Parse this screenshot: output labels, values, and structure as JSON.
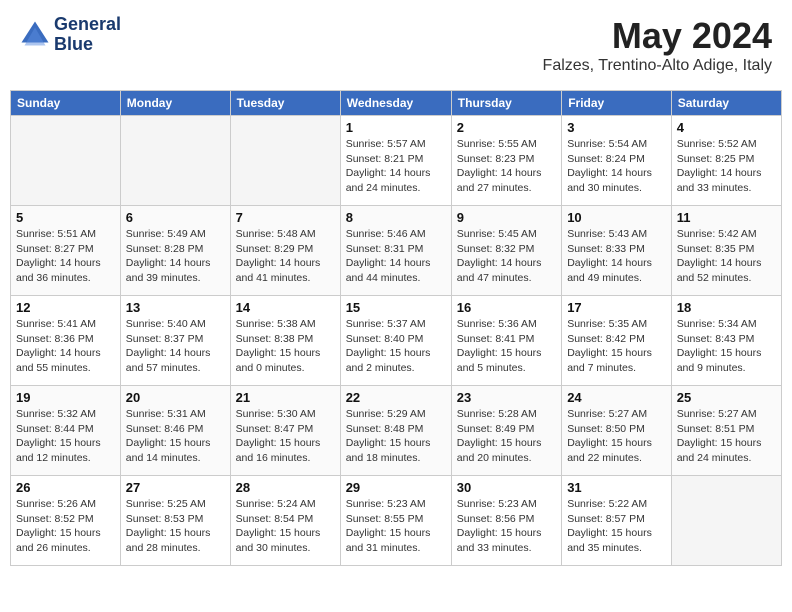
{
  "header": {
    "logo_line1": "General",
    "logo_line2": "Blue",
    "month": "May 2024",
    "location": "Falzes, Trentino-Alto Adige, Italy"
  },
  "weekdays": [
    "Sunday",
    "Monday",
    "Tuesday",
    "Wednesday",
    "Thursday",
    "Friday",
    "Saturday"
  ],
  "weeks": [
    [
      {
        "day": "",
        "info": ""
      },
      {
        "day": "",
        "info": ""
      },
      {
        "day": "",
        "info": ""
      },
      {
        "day": "1",
        "info": "Sunrise: 5:57 AM\nSunset: 8:21 PM\nDaylight: 14 hours and 24 minutes."
      },
      {
        "day": "2",
        "info": "Sunrise: 5:55 AM\nSunset: 8:23 PM\nDaylight: 14 hours and 27 minutes."
      },
      {
        "day": "3",
        "info": "Sunrise: 5:54 AM\nSunset: 8:24 PM\nDaylight: 14 hours and 30 minutes."
      },
      {
        "day": "4",
        "info": "Sunrise: 5:52 AM\nSunset: 8:25 PM\nDaylight: 14 hours and 33 minutes."
      }
    ],
    [
      {
        "day": "5",
        "info": "Sunrise: 5:51 AM\nSunset: 8:27 PM\nDaylight: 14 hours and 36 minutes."
      },
      {
        "day": "6",
        "info": "Sunrise: 5:49 AM\nSunset: 8:28 PM\nDaylight: 14 hours and 39 minutes."
      },
      {
        "day": "7",
        "info": "Sunrise: 5:48 AM\nSunset: 8:29 PM\nDaylight: 14 hours and 41 minutes."
      },
      {
        "day": "8",
        "info": "Sunrise: 5:46 AM\nSunset: 8:31 PM\nDaylight: 14 hours and 44 minutes."
      },
      {
        "day": "9",
        "info": "Sunrise: 5:45 AM\nSunset: 8:32 PM\nDaylight: 14 hours and 47 minutes."
      },
      {
        "day": "10",
        "info": "Sunrise: 5:43 AM\nSunset: 8:33 PM\nDaylight: 14 hours and 49 minutes."
      },
      {
        "day": "11",
        "info": "Sunrise: 5:42 AM\nSunset: 8:35 PM\nDaylight: 14 hours and 52 minutes."
      }
    ],
    [
      {
        "day": "12",
        "info": "Sunrise: 5:41 AM\nSunset: 8:36 PM\nDaylight: 14 hours and 55 minutes."
      },
      {
        "day": "13",
        "info": "Sunrise: 5:40 AM\nSunset: 8:37 PM\nDaylight: 14 hours and 57 minutes."
      },
      {
        "day": "14",
        "info": "Sunrise: 5:38 AM\nSunset: 8:38 PM\nDaylight: 15 hours and 0 minutes."
      },
      {
        "day": "15",
        "info": "Sunrise: 5:37 AM\nSunset: 8:40 PM\nDaylight: 15 hours and 2 minutes."
      },
      {
        "day": "16",
        "info": "Sunrise: 5:36 AM\nSunset: 8:41 PM\nDaylight: 15 hours and 5 minutes."
      },
      {
        "day": "17",
        "info": "Sunrise: 5:35 AM\nSunset: 8:42 PM\nDaylight: 15 hours and 7 minutes."
      },
      {
        "day": "18",
        "info": "Sunrise: 5:34 AM\nSunset: 8:43 PM\nDaylight: 15 hours and 9 minutes."
      }
    ],
    [
      {
        "day": "19",
        "info": "Sunrise: 5:32 AM\nSunset: 8:44 PM\nDaylight: 15 hours and 12 minutes."
      },
      {
        "day": "20",
        "info": "Sunrise: 5:31 AM\nSunset: 8:46 PM\nDaylight: 15 hours and 14 minutes."
      },
      {
        "day": "21",
        "info": "Sunrise: 5:30 AM\nSunset: 8:47 PM\nDaylight: 15 hours and 16 minutes."
      },
      {
        "day": "22",
        "info": "Sunrise: 5:29 AM\nSunset: 8:48 PM\nDaylight: 15 hours and 18 minutes."
      },
      {
        "day": "23",
        "info": "Sunrise: 5:28 AM\nSunset: 8:49 PM\nDaylight: 15 hours and 20 minutes."
      },
      {
        "day": "24",
        "info": "Sunrise: 5:27 AM\nSunset: 8:50 PM\nDaylight: 15 hours and 22 minutes."
      },
      {
        "day": "25",
        "info": "Sunrise: 5:27 AM\nSunset: 8:51 PM\nDaylight: 15 hours and 24 minutes."
      }
    ],
    [
      {
        "day": "26",
        "info": "Sunrise: 5:26 AM\nSunset: 8:52 PM\nDaylight: 15 hours and 26 minutes."
      },
      {
        "day": "27",
        "info": "Sunrise: 5:25 AM\nSunset: 8:53 PM\nDaylight: 15 hours and 28 minutes."
      },
      {
        "day": "28",
        "info": "Sunrise: 5:24 AM\nSunset: 8:54 PM\nDaylight: 15 hours and 30 minutes."
      },
      {
        "day": "29",
        "info": "Sunrise: 5:23 AM\nSunset: 8:55 PM\nDaylight: 15 hours and 31 minutes."
      },
      {
        "day": "30",
        "info": "Sunrise: 5:23 AM\nSunset: 8:56 PM\nDaylight: 15 hours and 33 minutes."
      },
      {
        "day": "31",
        "info": "Sunrise: 5:22 AM\nSunset: 8:57 PM\nDaylight: 15 hours and 35 minutes."
      },
      {
        "day": "",
        "info": ""
      }
    ]
  ]
}
